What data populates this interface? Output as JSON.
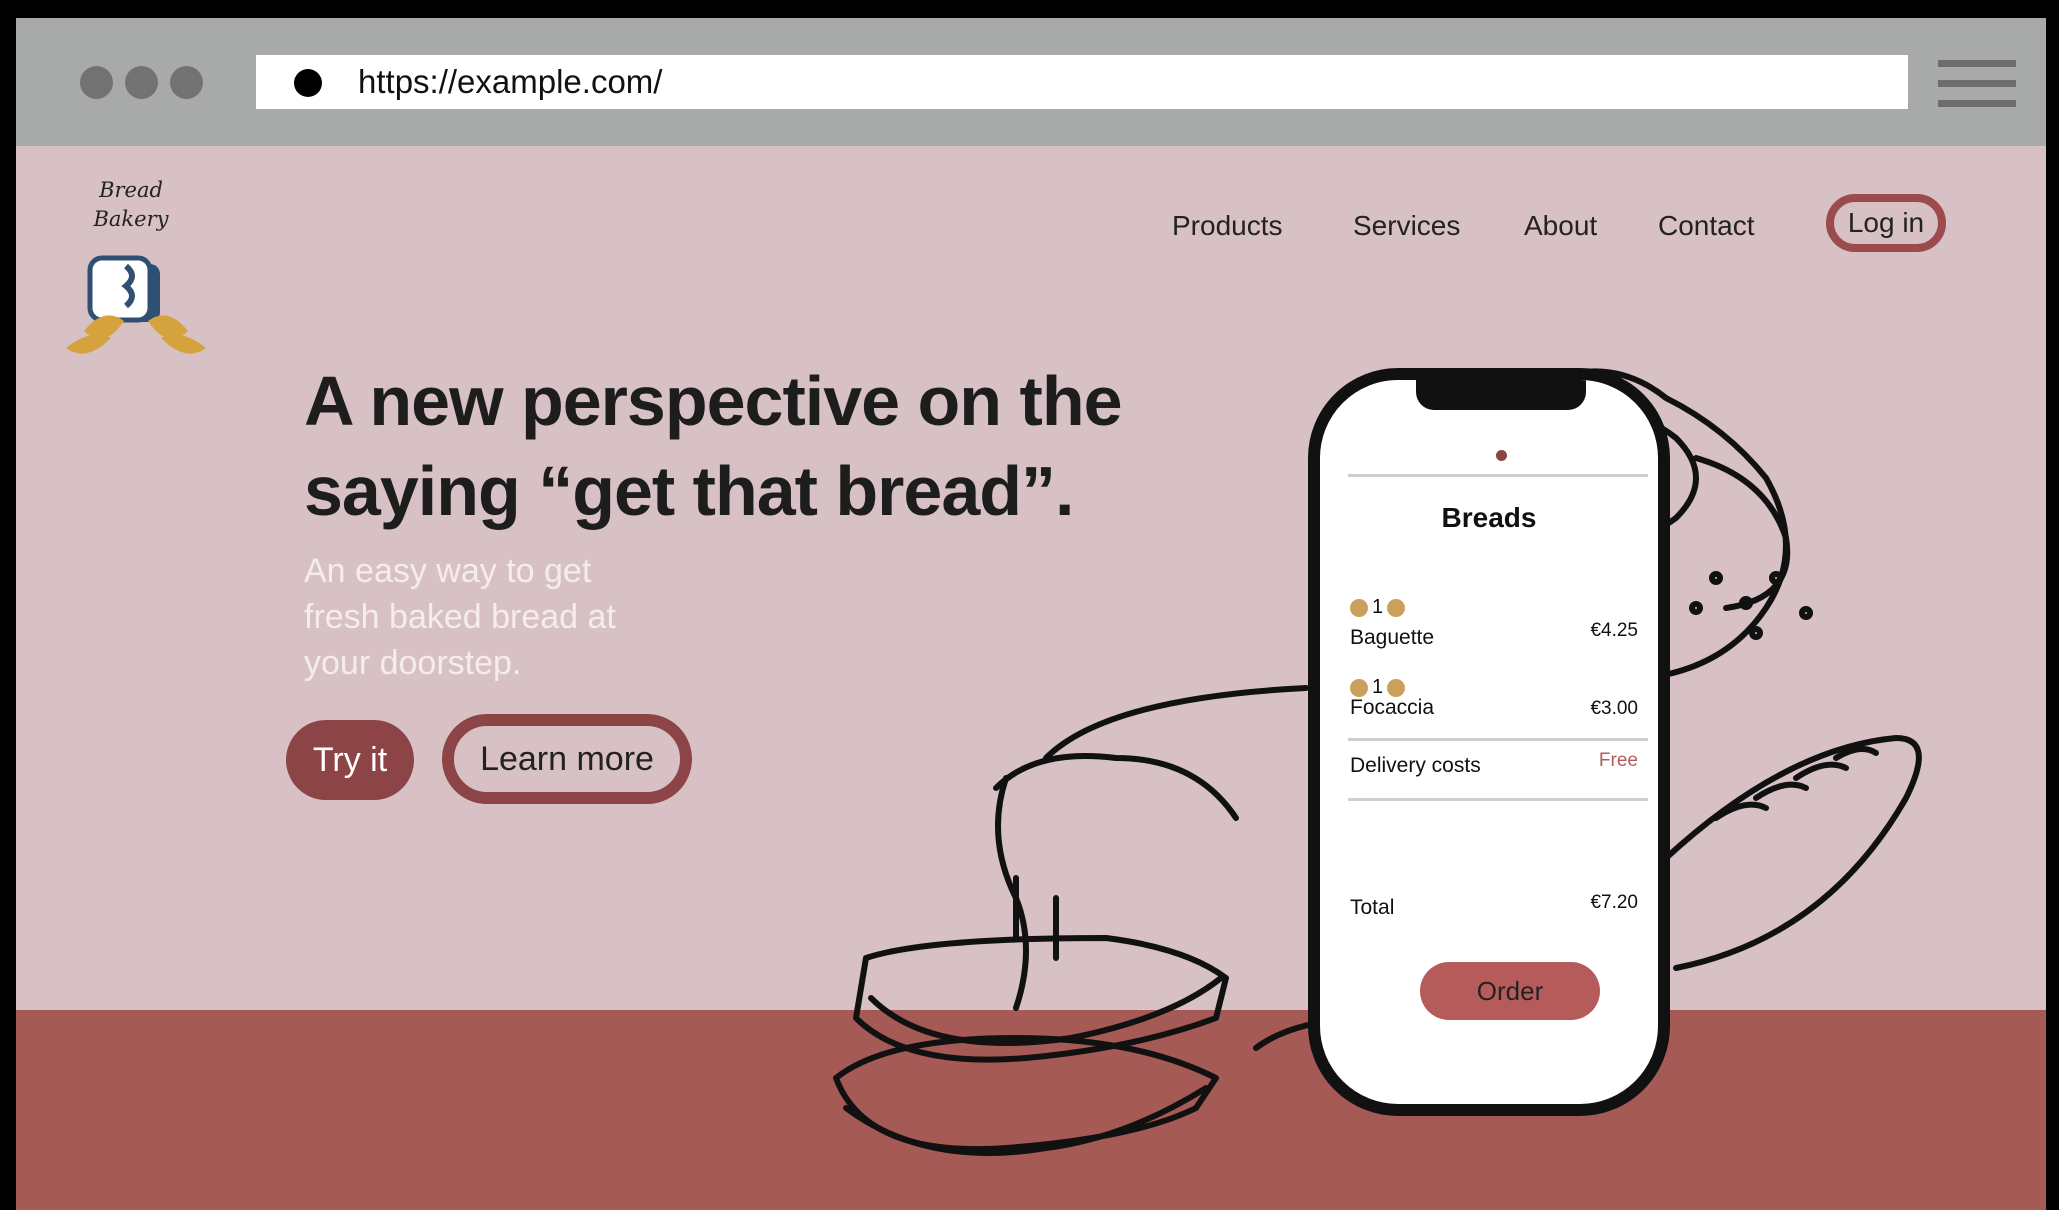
{
  "browser": {
    "url": "https://example.com/"
  },
  "brand": {
    "logo_text": "Bread Bakery"
  },
  "nav": {
    "items": [
      {
        "label": "Products"
      },
      {
        "label": "Services"
      },
      {
        "label": "About"
      },
      {
        "label": "Contact"
      }
    ],
    "login_label": "Log in"
  },
  "hero": {
    "headline": "A new perspective on the saying “get that bread”.",
    "subtitle": "An easy way to get fresh baked bread at your doorstep.",
    "try_label": "Try it",
    "learn_label": "Learn more"
  },
  "phone": {
    "title": "Breads",
    "items": [
      {
        "qty": "1",
        "name": "Baguette",
        "price": "€4.25"
      },
      {
        "qty": "1",
        "name": "Focaccia",
        "price": "€3.00"
      }
    ],
    "delivery_label": "Delivery costs",
    "delivery_value": "Free",
    "total_label": "Total",
    "total_value": "€7.20",
    "order_label": "Order"
  },
  "colors": {
    "background": "#d8c1c5",
    "accent": "#8d4446",
    "floor": "#a55a55",
    "chrome": "#a8aaa9"
  }
}
